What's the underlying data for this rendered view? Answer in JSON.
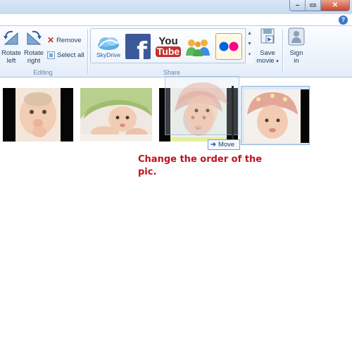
{
  "window": {
    "minimize_glyph": "–",
    "restore_glyph": "▭",
    "close_glyph": "✕",
    "help_glyph": "?"
  },
  "ribbon": {
    "editing": {
      "label": "Editing",
      "rotate_left_line1": "Rotate",
      "rotate_left_line2": "left",
      "rotate_right_line1": "Rotate",
      "rotate_right_line2": "right",
      "remove": "Remove",
      "select_all": "Select all"
    },
    "share": {
      "label": "Share",
      "skydrive": "SkyDrive",
      "youtube_line1": "You",
      "youtube_line2": "Tube",
      "save_movie_line1": "Save",
      "save_movie_line2": "movie"
    },
    "signin": {
      "line1": "Sign",
      "line2": "in"
    }
  },
  "storyboard": {
    "move_tooltip": "Move"
  },
  "instruction": "Change the order of the pic.",
  "colors": {
    "accent_red": "#c0101e",
    "ribbon_text": "#1e395b",
    "facebook_blue": "#3b5998",
    "youtube_red": "#c4302b",
    "flickr_blue": "#0063dc",
    "flickr_pink": "#ff0084"
  },
  "icons": [
    "rotate-left-icon",
    "rotate-right-icon",
    "remove-x-icon",
    "select-all-icon",
    "skydrive-icon",
    "facebook-icon",
    "youtube-icon",
    "messenger-icon",
    "flickr-icon",
    "save-movie-icon",
    "sign-in-icon",
    "move-arrow-icon"
  ]
}
